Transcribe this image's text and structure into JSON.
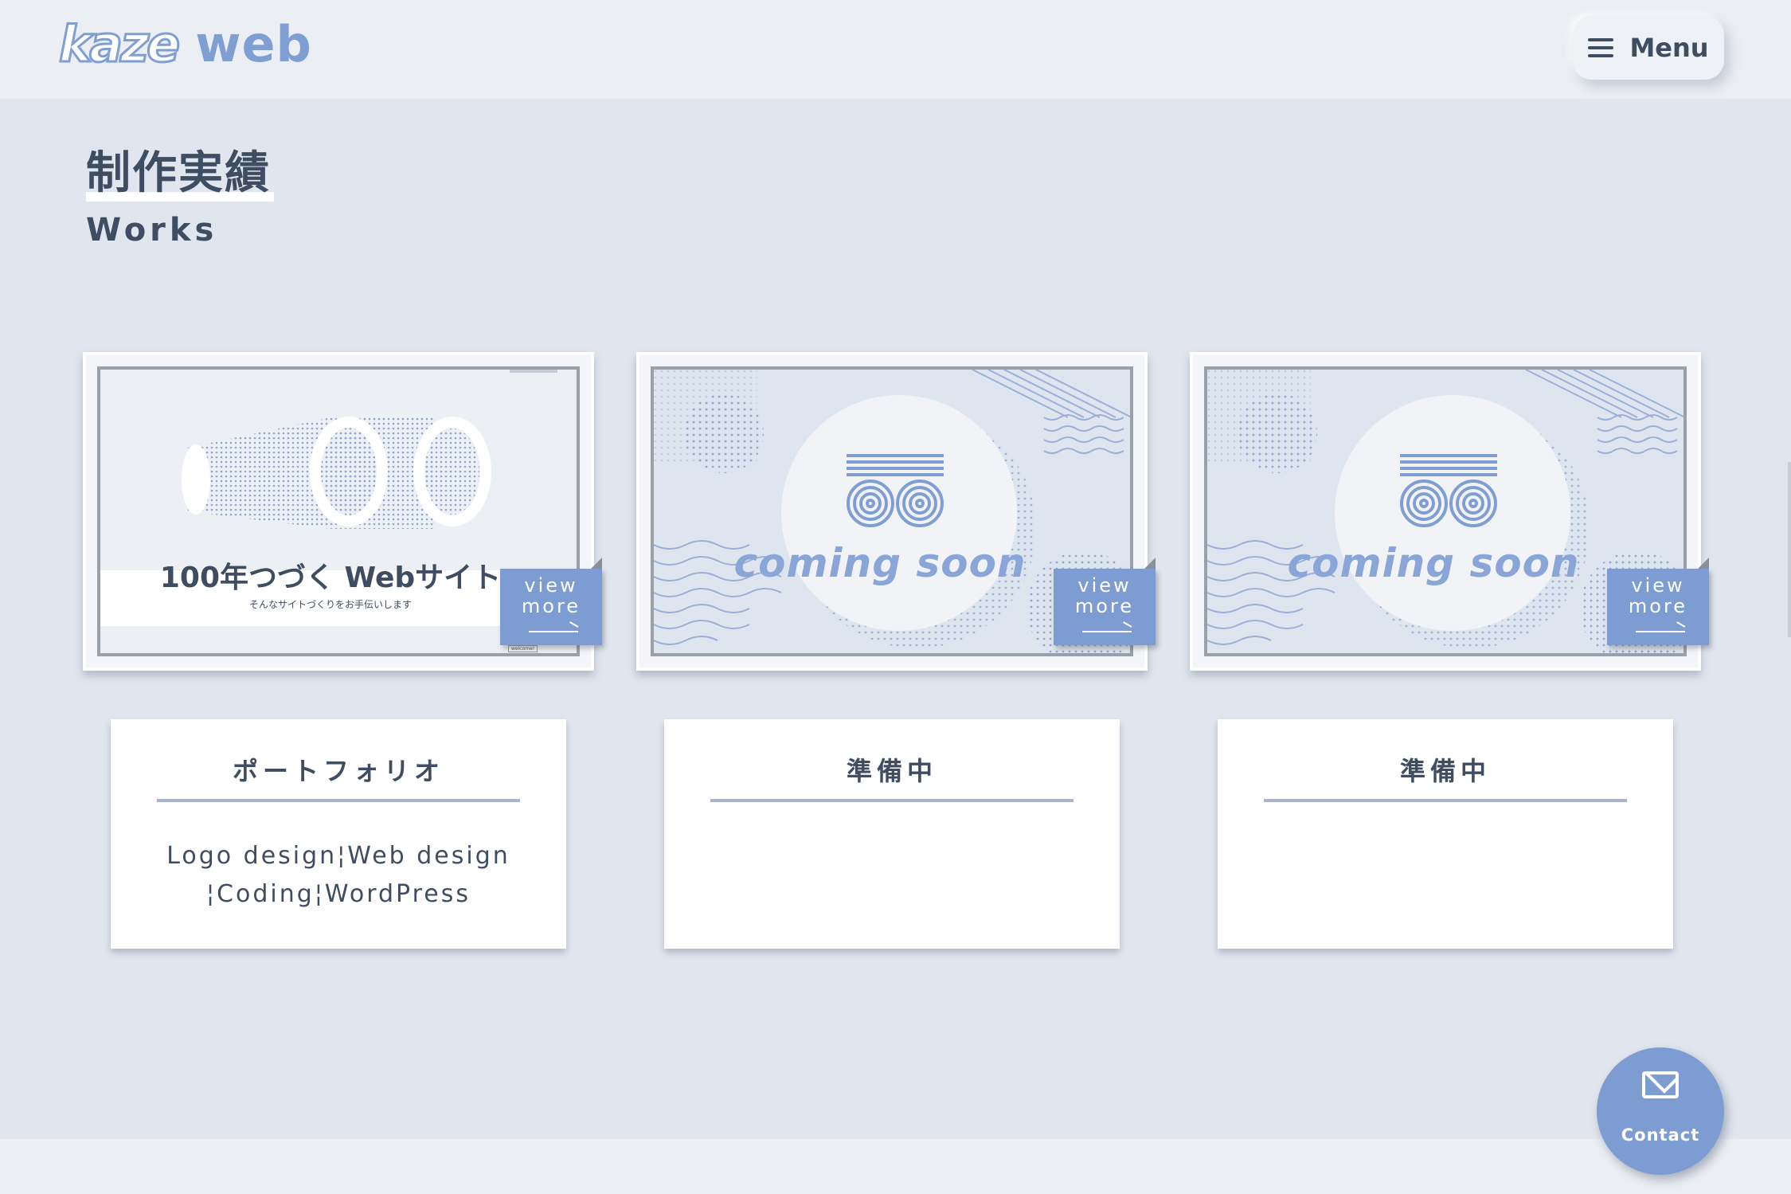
{
  "header": {
    "logo_kaze": "kaze",
    "logo_web": "web",
    "menu_label": "Menu"
  },
  "page": {
    "title_jp": "制作実績",
    "title_en": "Works"
  },
  "works": [
    {
      "hero_title": "100年つづく Webサイト",
      "hero_sub": "そんなサイトづくりをお手伝いします",
      "hero_tag": "welcome!",
      "view_more": "view\nmore",
      "card_title": "ポートフォリオ",
      "card_desc_line1": "Logo design¦Web design",
      "card_desc_line2": "¦Coding¦WordPress"
    },
    {
      "coming": "coming soon",
      "view_more": "view\nmore",
      "card_title": "準備中"
    },
    {
      "coming": "coming soon",
      "view_more": "view\nmore",
      "card_title": "準備中"
    }
  ],
  "contact": {
    "label": "Contact",
    "icon": "mail-icon"
  },
  "colors": {
    "accent": "#7d9dd2",
    "background": "#e1e6ee",
    "text": "#3f4d62"
  }
}
